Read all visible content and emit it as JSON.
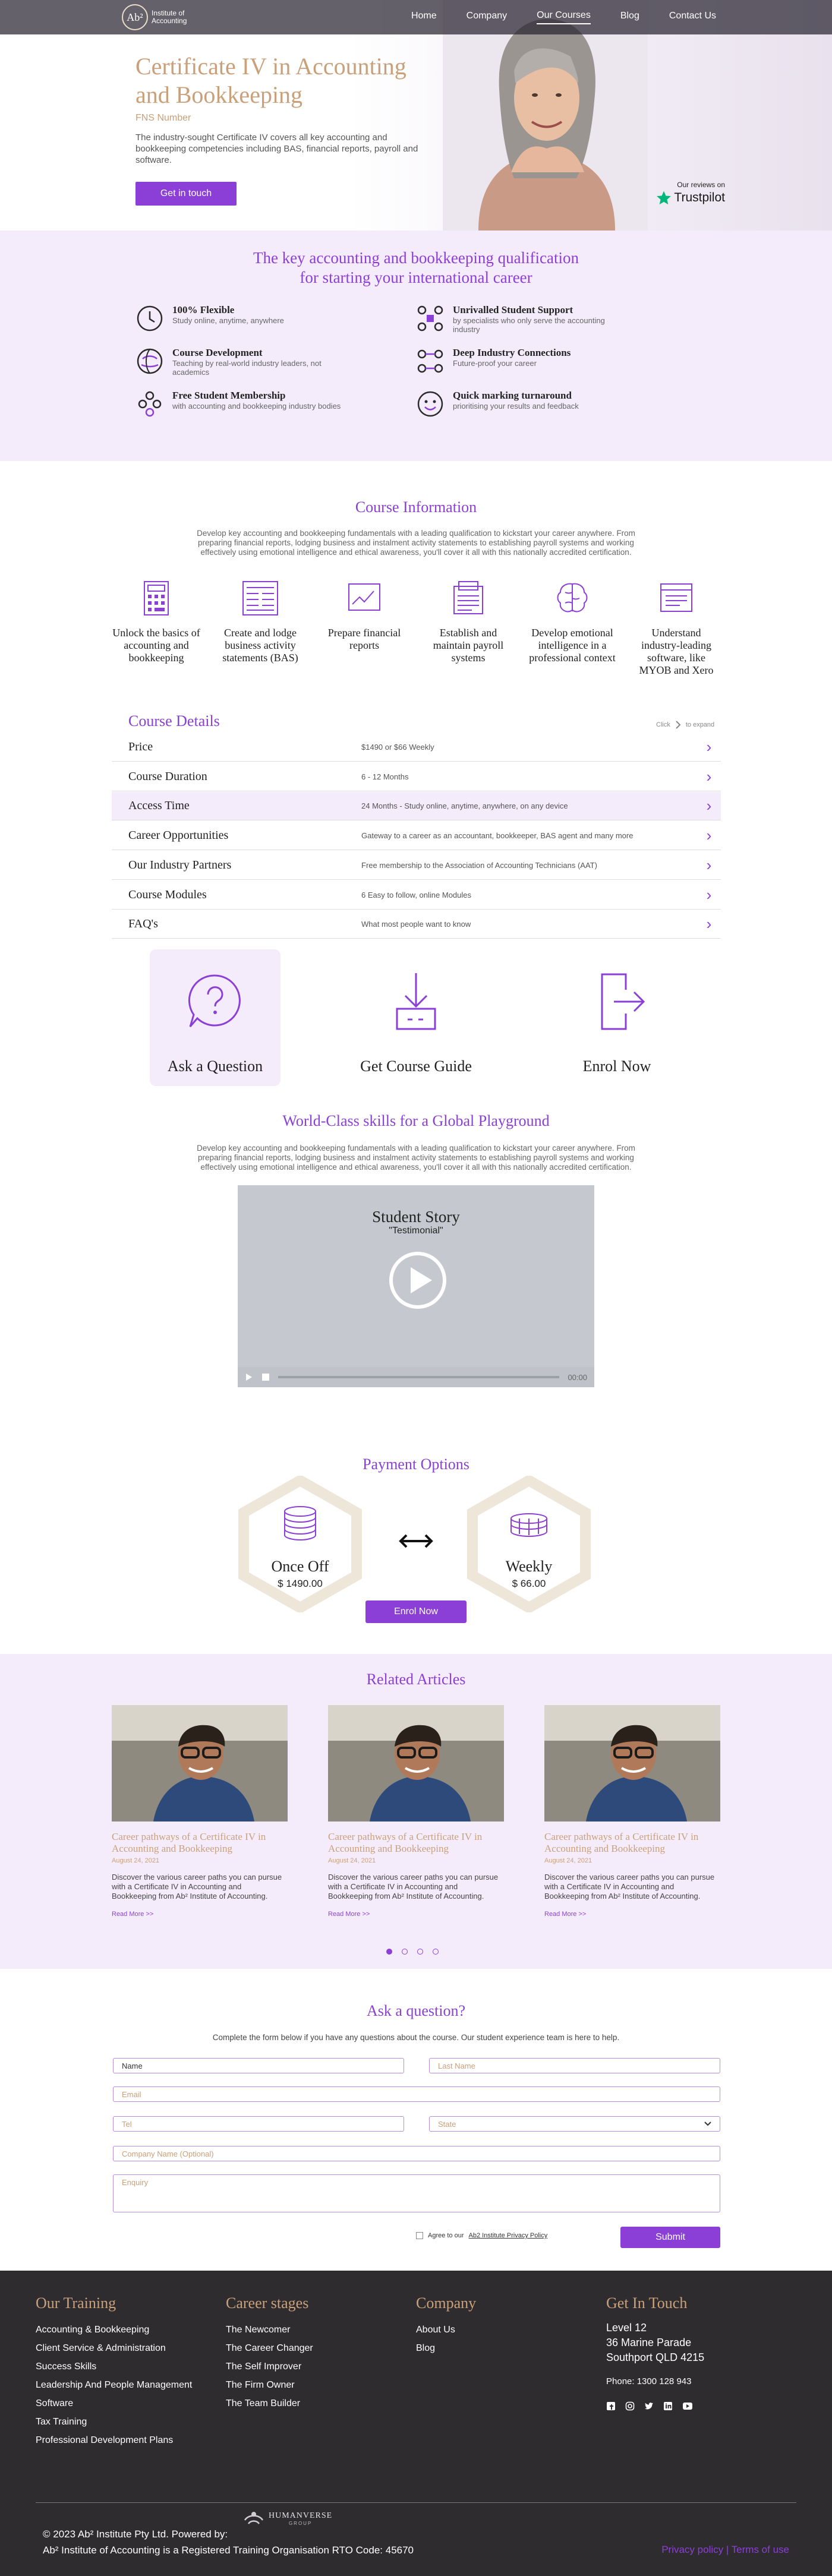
{
  "nav": {
    "logo_mark": "Ab²",
    "logo_line1": "Institute of",
    "logo_line2": "Accounting",
    "links": [
      "Home",
      "Company",
      "Our Courses",
      "Blog",
      "Contact Us"
    ]
  },
  "hero": {
    "title": "Certificate IV in Accounting and Bookkeeping",
    "code": "FNS Number",
    "intro": "The industry-sought Certificate IV covers all key accounting and bookkeeping competencies including BAS, financial reports, payroll and software.",
    "cta": "Get in touch",
    "trustpilot_caption": "Our reviews on",
    "trustpilot_name": "Trustpilot"
  },
  "features": {
    "heading_line1": "The key accounting and bookkeeping qualification",
    "heading_line2": "for starting your international career",
    "items": [
      {
        "title": "100% Flexible",
        "sub": "Study online, anytime, anywhere"
      },
      {
        "title": "Unrivalled Student Support",
        "sub": "by specialists who only serve the accounting industry"
      },
      {
        "title": "Course Development",
        "sub": "Teaching by real-world industry leaders, not academics"
      },
      {
        "title": "Deep Industry Connections",
        "sub": "Future-proof your career"
      },
      {
        "title": "Free Student Membership",
        "sub": "with accounting and bookkeeping industry bodies"
      },
      {
        "title": "Quick marking turnaround",
        "sub": "prioritising your results and feedback"
      }
    ]
  },
  "course_info": {
    "title": "Course Information",
    "desc": "Develop key accounting and bookkeeping fundamentals with a leading qualification to kickstart your career anywhere. From preparing financial reports, lodging business and instalment activity statements to establishing payroll systems and working effectively using emotional intelligence and ethical awareness, you'll cover it all with this nationally accredited certification.",
    "items": [
      "Unlock the basics of accounting and bookkeeping",
      "Create and lodge business activity statements (BAS)",
      "Prepare financial reports",
      "Establish and maintain payroll systems",
      "Develop emotional intelligence in a professional context",
      "Understand industry-leading software, like MYOB and Xero"
    ]
  },
  "details": {
    "title": "Course Details",
    "hint_left": "Click",
    "hint_right": "to expand",
    "rows": [
      {
        "key": "Price",
        "value": "$1490 or $66 Weekly"
      },
      {
        "key": "Course Duration",
        "value": "6 - 12 Months"
      },
      {
        "key": "Access Time",
        "value": "24 Months - Study online, anytime, anywhere, on any device"
      },
      {
        "key": "Career Opportunities",
        "value": "Gateway to a career as an accountant, bookkeeper, BAS agent and many more"
      },
      {
        "key": "Our Industry Partners",
        "value": "Free membership to the Association of Accounting Technicians (AAT)"
      },
      {
        "key": "Course Modules",
        "value": "6 Easy to follow, online Modules"
      },
      {
        "key": "FAQ's",
        "value": "What most people want to know"
      }
    ]
  },
  "actions": [
    "Ask a Question",
    "Get Course Guide",
    "Enrol Now"
  ],
  "world": {
    "title": "World-Class skills for a Global Playground",
    "desc": "Develop key accounting and bookkeeping fundamentals with a leading qualification to kickstart your career anywhere. From preparing financial reports, lodging business and instalment activity statements to establishing payroll systems and working effectively using emotional intelligence and ethical awareness, you'll cover it all with this nationally accredited certification.",
    "video_title": "Student Story",
    "video_sub": "\"Testimonial\"",
    "video_time": "00:00"
  },
  "payment": {
    "title": "Payment Options",
    "once_label": "Once Off",
    "once_price": "$ 1490.00",
    "weekly_label": "Weekly",
    "weekly_price": "$ 66.00",
    "cta": "Enrol Now"
  },
  "articles": {
    "title": "Related Articles",
    "items": [
      {
        "title": "Career pathways of a Certificate IV in Accounting and Bookkeeping",
        "date": "August 24, 2021",
        "text": "Discover the various career paths you can pursue with a Certificate IV in Accounting and Bookkeeping from Ab² Institute of Accounting.",
        "more": "Read More >>"
      },
      {
        "title": "Career pathways of a Certificate IV in Accounting and Bookkeeping",
        "date": "August 24, 2021",
        "text": "Discover the various career paths you can pursue with a Certificate IV in Accounting and Bookkeeping from Ab² Institute of Accounting.",
        "more": "Read More >>"
      },
      {
        "title": "Career pathways of a Certificate IV in Accounting and Bookkeeping",
        "date": "August 24, 2021",
        "text": "Discover the various career paths you can pursue with a Certificate IV in Accounting and Bookkeeping from Ab² Institute of Accounting.",
        "more": "Read More >>"
      }
    ]
  },
  "form": {
    "title": "Ask a question?",
    "desc": "Complete the form below if you have any questions about the course. Our student experience team is here to help.",
    "name": "Name",
    "last_name": "Last Name",
    "email": "Email",
    "tel": "Tel",
    "state": "State",
    "company": "Company Name (Optional)",
    "enquiry": "Enquiry",
    "agree_text": "Agree to our",
    "agree_link": "Ab2 Institute Privacy Policy",
    "submit": "Submit"
  },
  "footer": {
    "training_title": "Our Training",
    "training": [
      "Accounting & Bookkeeping",
      "Client Service & Administration",
      "Success Skills",
      "Leadership And People Management",
      "Software",
      "Tax Training",
      "Professional Development Plans"
    ],
    "stages_title": "Career stages",
    "stages": [
      "The Newcomer",
      "The Career Changer",
      "The Self Improver",
      "The Firm Owner",
      "The Team Builder"
    ],
    "company_title": "Company",
    "company": [
      "About Us",
      "Blog"
    ],
    "contact_title": "Get In Touch",
    "address1": "Level 12",
    "address2": "36 Marine Parade",
    "address3": "Southport QLD 4215",
    "phone": "Phone: 1300 128 943",
    "copyright": "© 2023 Ab² Institute Pty Ltd.  Powered by:",
    "rto": "Ab² Institute of Accounting is a Registered Training Organisation RTO Code: 45670",
    "humanverse": "HUMANVERSE",
    "humanverse_sub": "GROUP",
    "legal": "Privacy policy | Terms of use"
  }
}
